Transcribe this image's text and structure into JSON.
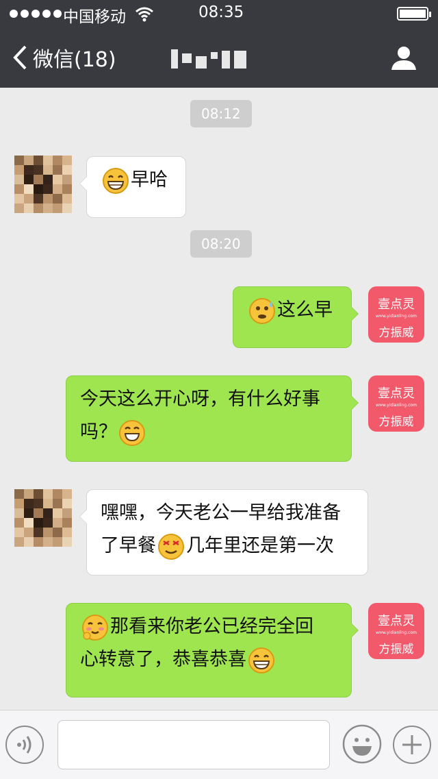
{
  "status_bar": {
    "carrier": "中国移动",
    "time": "08:35"
  },
  "nav": {
    "back_label": "微信(18)",
    "title": ""
  },
  "messages": {
    "t1": "08:12",
    "m1": "早哈",
    "t2": "08:20",
    "m2": "这么早",
    "m3_line1": "今天这么开心呀，有什么好事",
    "m3_line2": "吗？",
    "m4_line1": "嘿嘿，今天老公一早给我准备",
    "m4_line2a": "了早餐",
    "m4_line2b": "几年里还是第一次",
    "m5_line1": "那看来你老公已经完全回",
    "m5_line2": "心转意了，恭喜恭喜"
  },
  "self_avatar": {
    "brand": "壹点灵",
    "site": "www.yidianling.com",
    "name": "方振威"
  },
  "colors": {
    "header": "#393a3f",
    "outgoing": "#9ee54f",
    "incoming": "#ffffff",
    "brand": "#f25a6c",
    "background": "#ebebeb"
  },
  "icons": [
    "chevron-left-icon",
    "wifi-icon",
    "battery-icon",
    "contact-icon",
    "voice-icon",
    "smile-icon",
    "plus-icon",
    "grin-emoji",
    "sweat-emoji",
    "smile-emoji",
    "star-eyes-emoji",
    "shy-emoji"
  ]
}
